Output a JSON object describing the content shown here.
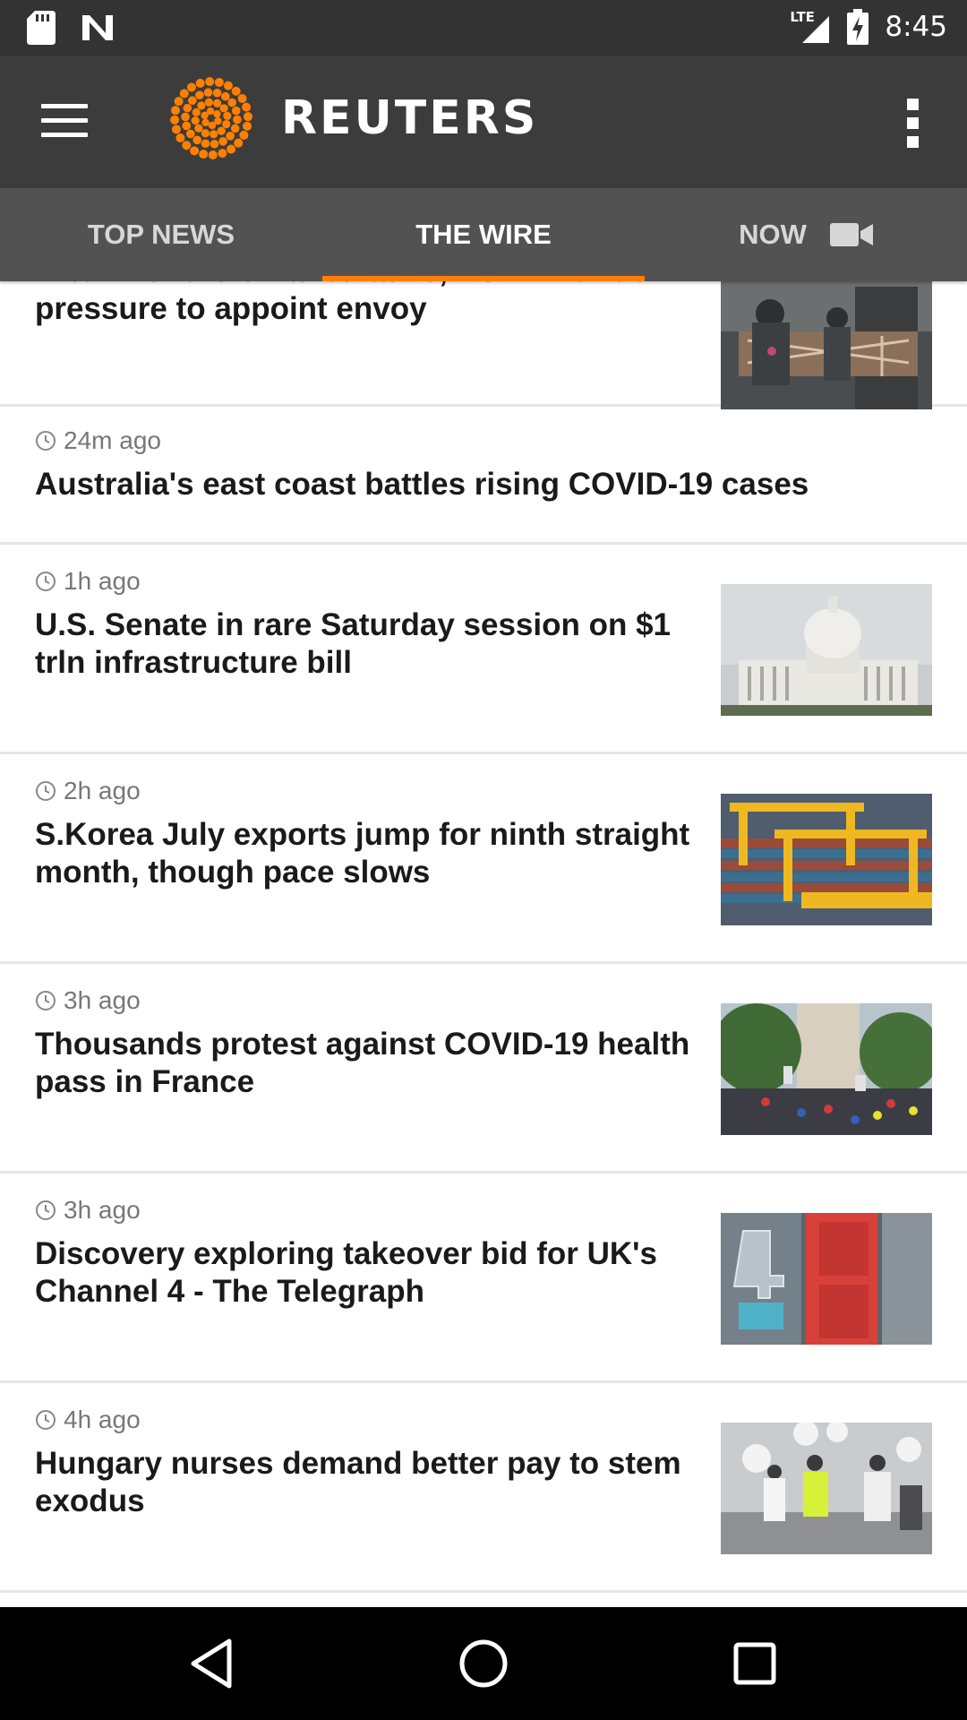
{
  "status_bar": {
    "network": "LTE",
    "time": "8:45",
    "icons": [
      "sd-card-icon",
      "n-notification-icon",
      "lte-signal-icon",
      "battery-charging-icon"
    ]
  },
  "app_bar": {
    "logo_text": "REUTERS",
    "brand_color": "#ff8000",
    "icons": [
      "hamburger-menu-icon",
      "reuters-logo",
      "overflow-menu-icon"
    ]
  },
  "tabs": [
    {
      "label": "TOP NEWS"
    },
    {
      "label": "THE WIRE",
      "active": true
    },
    {
      "label": "NOW",
      "icon": "video-camera-icon"
    }
  ],
  "stories": [
    {
      "time": "",
      "headline": "After months of failed talks, ASEAN under pressure to appoint envoy",
      "thumb": "soldiers-barricade-photo"
    },
    {
      "time": "24m ago",
      "headline": "Australia's east coast battles rising COVID-19 cases",
      "thumb": ""
    },
    {
      "time": "1h ago",
      "headline": "U.S. Senate in rare Saturday session on $1 trln infrastructure bill",
      "thumb": "capitol-building-photo"
    },
    {
      "time": "2h ago",
      "headline": "S.Korea July exports jump for ninth straight month, though pace slows",
      "thumb": "container-port-cranes-photo"
    },
    {
      "time": "3h ago",
      "headline": "Thousands protest against COVID-19 health pass in France",
      "thumb": "paris-protest-crowd-photo"
    },
    {
      "time": "3h ago",
      "headline": "Discovery exploring takeover bid for UK's Channel 4 - The Telegraph",
      "thumb": "channel-4-building-photo"
    },
    {
      "time": "4h ago",
      "headline": "Hungary nurses demand better pay to stem exodus",
      "thumb": "nurses-march-balloons-photo"
    }
  ],
  "nav_bar": {
    "icons": [
      "back-triangle-icon",
      "home-circle-icon",
      "recents-square-icon"
    ]
  }
}
